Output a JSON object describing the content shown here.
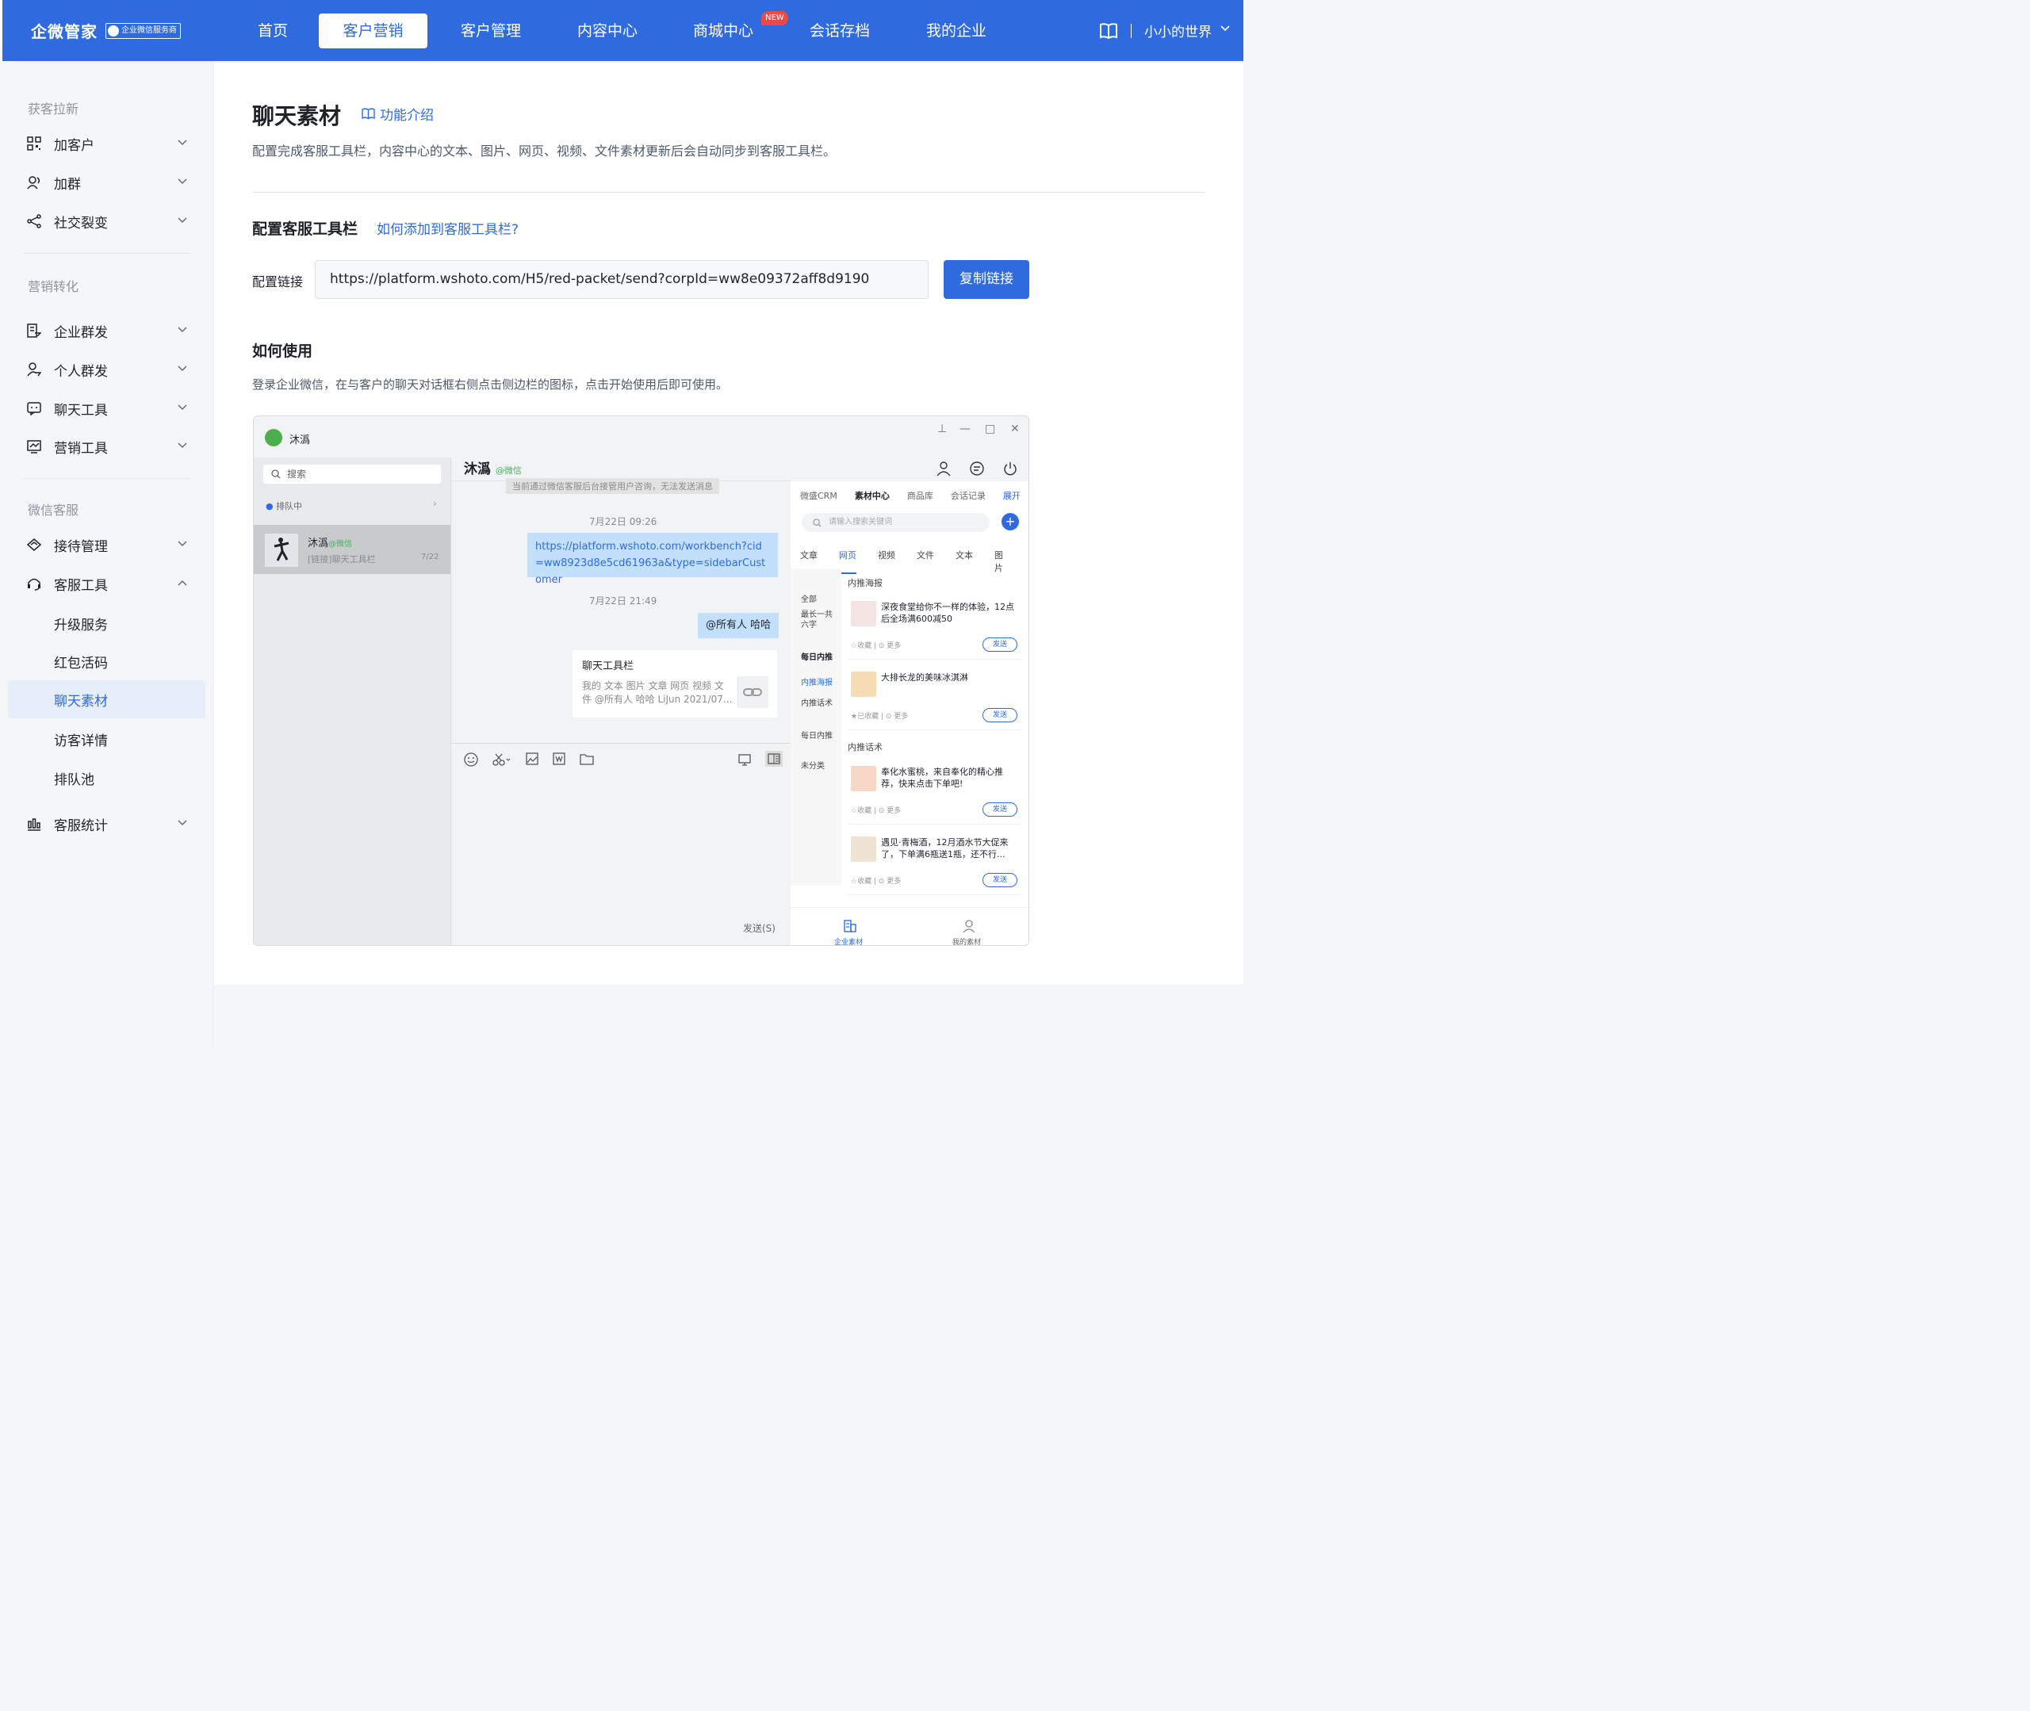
{
  "header": {
    "logo": "企微管家",
    "badge": "企业微信服务商",
    "nav": [
      "首页",
      "客户营销",
      "客户管理",
      "内容中心",
      "商城中心",
      "会话存档",
      "我的企业"
    ],
    "nav_active": 1,
    "new_tag": "NEW",
    "user": "小小的世界"
  },
  "sidebar": {
    "groups": [
      "获客拉新",
      "营销转化",
      "微信客服"
    ],
    "items": [
      {
        "label": "加客户",
        "icon": "qrcode-icon"
      },
      {
        "label": "加群",
        "icon": "group-add-icon"
      },
      {
        "label": "社交裂变",
        "icon": "share-icon"
      },
      {
        "label": "企业群发",
        "icon": "enterprise-send-icon"
      },
      {
        "label": "个人群发",
        "icon": "personal-send-icon"
      },
      {
        "label": "聊天工具",
        "icon": "chat-tool-icon"
      },
      {
        "label": "营销工具",
        "icon": "marketing-tool-icon"
      },
      {
        "label": "接待管理",
        "icon": "reception-icon"
      },
      {
        "label": "客服工具",
        "icon": "headset-icon"
      },
      {
        "label": "客服统计",
        "icon": "stats-icon"
      }
    ],
    "subitems": [
      "升级服务",
      "红包活码",
      "聊天素材",
      "访客详情",
      "排队池"
    ],
    "active_sub": "聊天素材"
  },
  "main": {
    "title": "聊天素材",
    "intro_link": "功能介绍",
    "description": "配置完成客服工具栏，内容中心的文本、图片、网页、视频、文件素材更新后会自动同步到客服工具栏。",
    "config_title": "配置客服工具栏",
    "config_help": "如何添加到客服工具栏?",
    "config_label": "配置链接",
    "config_url": "https://platform.wshoto.com/H5/red-packet/send?corpId=ww8e09372aff8d9190",
    "copy_button": "复制链接",
    "usage_title": "如何使用",
    "usage_desc": "登录企业微信，在与客户的聊天对话框右侧点击侧边栏的图标，点击开始使用后即可使用。"
  },
  "demo": {
    "window_user": "沐潙",
    "search": "搜索",
    "queue": "排队中",
    "contact_name": "沐潙",
    "contact_tag": "@微信",
    "contact_msg": "[链接]聊天工具栏",
    "contact_date": "7/22",
    "chat_name": "沐潙",
    "chat_tag": "@微信",
    "system_msg": "当前通过微信客服后台接管用户咨询，无法发送消息",
    "time1": "7月22日 09:26",
    "link_msg": "https://platform.wshoto.com/workbench?cid=ww8923d8e5cd61963a&type=sidebarCustomer",
    "time2": "7月22日 21:49",
    "mention_msg": "@所有人 哈哈",
    "card_title": "聊天工具栏",
    "card_desc": "我的 文本 图片 文章 网页 视频 文件 @所有人 哈哈 LiJun 2021/07...",
    "send_label": "发送(S)",
    "right_tabs": [
      "微盛CRM",
      "素材中心",
      "商品库",
      "会话记录",
      "展开"
    ],
    "right_search": "请输入搜索关键词",
    "type_tabs": [
      "文章",
      "网页",
      "视频",
      "文件",
      "文本",
      "图片"
    ],
    "categories": [
      "全部",
      "最长一共六字",
      "每日内推",
      "内推海报",
      "内推话术",
      "每日内推",
      "未分类"
    ],
    "section1": "内推海报",
    "section2": "内推话术",
    "materials": [
      {
        "title": "深夜食堂给你不一样的体验，12点后全场满600减50",
        "meta": "☆收藏  |  ⊙ 更多"
      },
      {
        "title": "大排长龙的美味冰淇淋",
        "meta": "★已收藏  |  ⊙ 更多"
      },
      {
        "title": "奉化水蜜桃，来自奉化的精心推荐，快来点击下单吧!",
        "meta": "☆收藏  |  ⊙ 更多"
      },
      {
        "title": "遇见·青梅酒，12月酒水节大促来了，下单满6瓶送1瓶，还不行...",
        "meta": "☆收藏  |  ⊙ 更多"
      }
    ],
    "send_button": "发送",
    "bottom_tab1": "企业素材",
    "bottom_tab2": "我的素材"
  },
  "colors": {
    "brand": "#2f6bde",
    "new_tag": "#f04848"
  }
}
